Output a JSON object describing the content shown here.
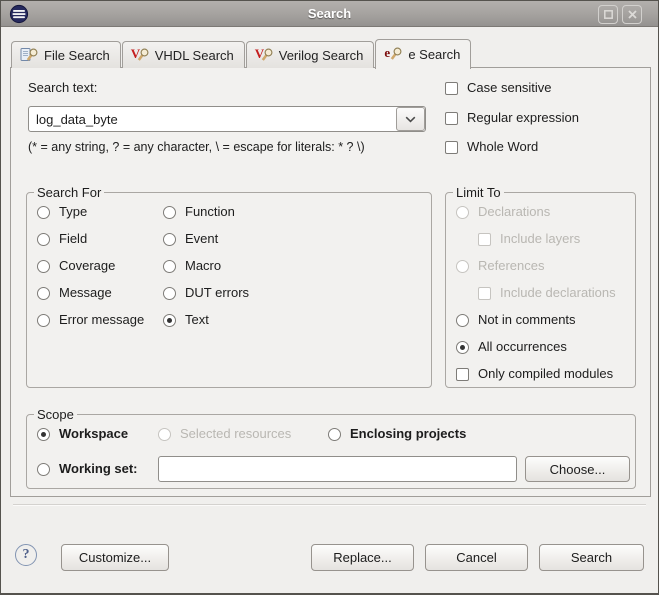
{
  "window": {
    "title": "Search"
  },
  "tabs": [
    {
      "label": "File Search"
    },
    {
      "label": "VHDL Search",
      "icon_letter": "V"
    },
    {
      "label": "Verilog Search",
      "icon_letter": "V"
    },
    {
      "label": "e Search",
      "icon_letter": "e",
      "active": true
    }
  ],
  "search": {
    "label": "Search text:",
    "value": "log_data_byte",
    "hint": "(* = any string, ? = any character, \\ = escape for literals: * ? \\)"
  },
  "options": {
    "case_sensitive": "Case sensitive",
    "regular_expression": "Regular expression",
    "whole_word": "Whole Word"
  },
  "search_for": {
    "title": "Search For",
    "col1": [
      "Type",
      "Field",
      "Coverage",
      "Message",
      "Error message"
    ],
    "col2": [
      "Function",
      "Event",
      "Macro",
      "DUT errors",
      "Text"
    ],
    "selected": "Text"
  },
  "limit_to": {
    "title": "Limit To",
    "declarations": "Declarations",
    "include_layers": "Include layers",
    "references": "References",
    "include_declarations": "Include declarations",
    "not_in_comments": "Not in comments",
    "all_occurrences": "All occurrences",
    "only_compiled_modules": "Only compiled modules",
    "selected": "All occurrences"
  },
  "scope": {
    "title": "Scope",
    "workspace": "Workspace",
    "selected_resources": "Selected resources",
    "enclosing_projects": "Enclosing projects",
    "working_set": "Working set:",
    "working_set_value": "",
    "choose": "Choose...",
    "selected": "Workspace"
  },
  "footer": {
    "help": "?",
    "customize": "Customize...",
    "replace": "Replace...",
    "cancel": "Cancel",
    "search": "Search"
  }
}
